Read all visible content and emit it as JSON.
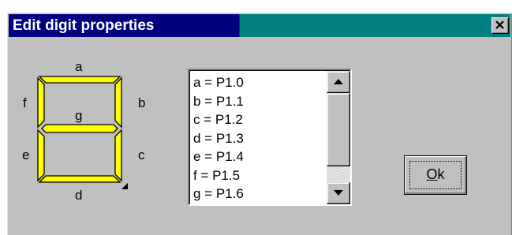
{
  "dialog": {
    "title": "Edit digit properties",
    "close_glyph": "×",
    "colors": {
      "title_active": "#000080",
      "title_teal": "#008080",
      "face": "#c0c0c0",
      "segment_fill": "#ffff00",
      "segment_outline": "#000000"
    }
  },
  "segment_labels": {
    "a": "a",
    "b": "b",
    "c": "c",
    "d": "d",
    "e": "e",
    "f": "f",
    "g": "g"
  },
  "pin_list": {
    "items": [
      "a = P1.0",
      "b = P1.1",
      "c = P1.2",
      "d = P1.3",
      "e = P1.4",
      "f = P1.5",
      "g = P1.6"
    ],
    "scroll_up_icon": "triangle-up-icon",
    "scroll_down_icon": "triangle-down-icon"
  },
  "buttons": {
    "ok_label": "Ok"
  }
}
